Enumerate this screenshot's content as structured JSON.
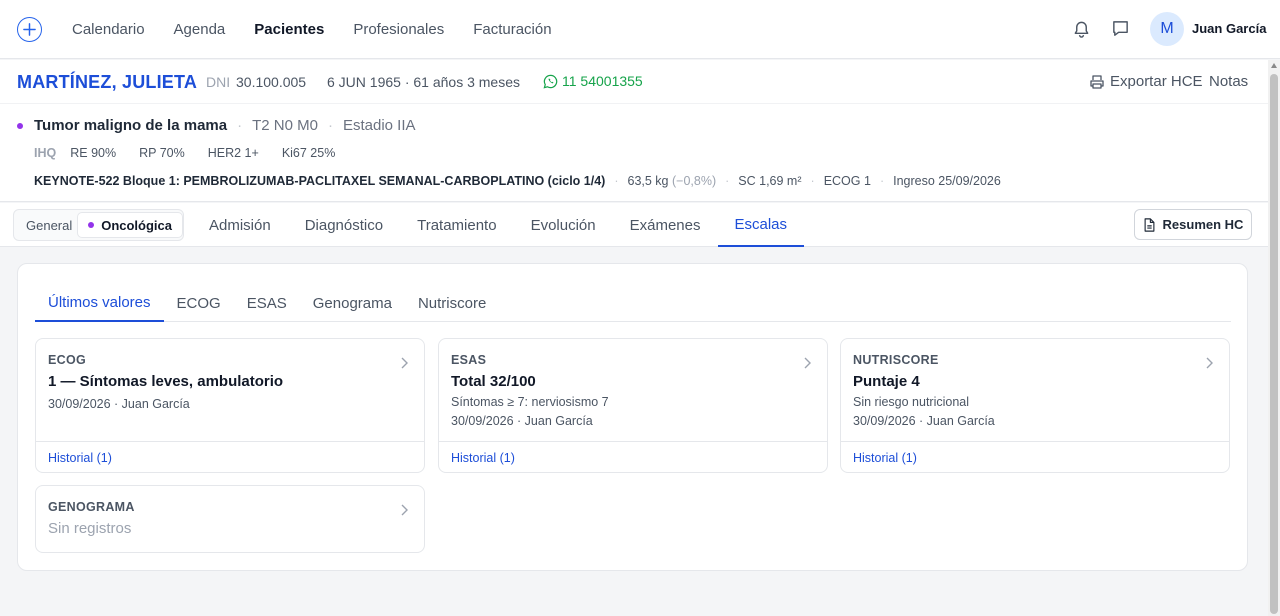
{
  "nav": {
    "items": [
      "Calendario",
      "Agenda",
      "Pacientes",
      "Profesionales",
      "Facturación"
    ],
    "active": "Pacientes",
    "user_initial": "M",
    "user_name": "Juan García"
  },
  "patient": {
    "name": "MARTÍNEZ, JULIETA",
    "dni_label": "DNI",
    "dni": "30.100.005",
    "dob_age": "6 JUN 1965 · 61 años 3 meses",
    "phone": "11 54001355",
    "export_label": "Exportar HCE",
    "notes_label": "Notas"
  },
  "diagnosis": {
    "title": "Tumor maligno de la mama",
    "tnm": "T2 N0 M0",
    "stage": "Estadio IIA",
    "ihq_label": "IHQ",
    "markers": [
      "RE 90%",
      "RP 70%",
      "HER2 1+",
      "Ki67 25%"
    ],
    "protocol": "KEYNOTE-522 Bloque 1: PEMBROLIZUMAB-PACLITAXEL SEMANAL-CARBOPLATINO (ciclo 1/4)",
    "weight": "63,5 kg",
    "weight_delta": "(−0,8%)",
    "sc": "SC 1,69 m²",
    "ecog": "ECOG 1",
    "ingreso": "Ingreso 25/09/2026"
  },
  "tabs": {
    "segment": [
      "General",
      "Oncológica"
    ],
    "main": [
      "Admisión",
      "Diagnóstico",
      "Tratamiento",
      "Evolución",
      "Exámenes",
      "Escalas"
    ],
    "active": "Escalas",
    "resumen_label": "Resumen HC"
  },
  "scales": {
    "subtabs": [
      "Últimos valores",
      "ECOG",
      "ESAS",
      "Genograma",
      "Nutriscore"
    ],
    "active": "Últimos valores",
    "cards": [
      {
        "label": "ECOG",
        "value": "1 — Síntomas leves, ambulatorio",
        "detail": "",
        "meta": "30/09/2026 · Juan García",
        "history": "Historial (1)"
      },
      {
        "label": "ESAS",
        "value": "Total 32/100",
        "detail": "Síntomas ≥ 7: nerviosismo 7",
        "meta": "30/09/2026 · Juan García",
        "history": "Historial (1)"
      },
      {
        "label": "NUTRISCORE",
        "value": "Puntaje 4",
        "detail": "Sin riesgo nutricional",
        "meta": "30/09/2026 · Juan García",
        "history": "Historial (1)"
      },
      {
        "label": "GENOGRAMA",
        "value": "",
        "empty": "Sin registros"
      }
    ]
  }
}
